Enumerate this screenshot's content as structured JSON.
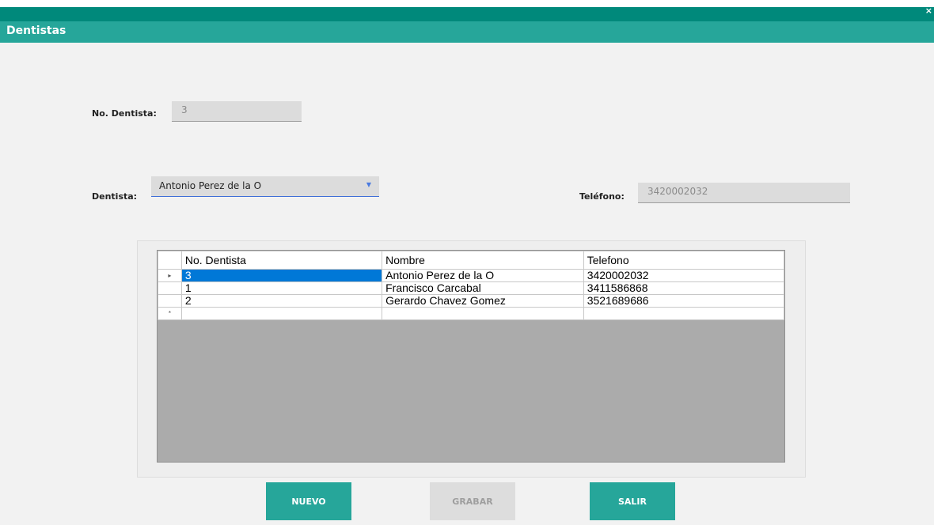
{
  "window": {
    "title": "Dentistas",
    "close_glyph": "×"
  },
  "form": {
    "no_dentista_label": "No. Dentista:",
    "no_dentista_value": "3",
    "dentista_label": "Dentista:",
    "dentista_selected": "Antonio Perez de la O",
    "telefono_label": "Teléfono:",
    "telefono_value": "3420002032"
  },
  "grid": {
    "headers": [
      "No. Dentista",
      "Nombre",
      "Telefono"
    ],
    "rows": [
      [
        "3",
        "Antonio Perez de la O",
        "3420002032"
      ],
      [
        "1",
        "Francisco Carcabal",
        "3411586868"
      ],
      [
        "2",
        "Gerardo Chavez Gomez",
        "3521689686"
      ]
    ],
    "current_row_marker": "▸",
    "new_row_marker": "*"
  },
  "buttons": {
    "nuevo": "NUEVO",
    "grabar": "GRABAR",
    "salir": "SALIR"
  },
  "colors": {
    "accent": "#26a69a",
    "accent_dark": "#00897b",
    "selection": "#0078d7"
  }
}
